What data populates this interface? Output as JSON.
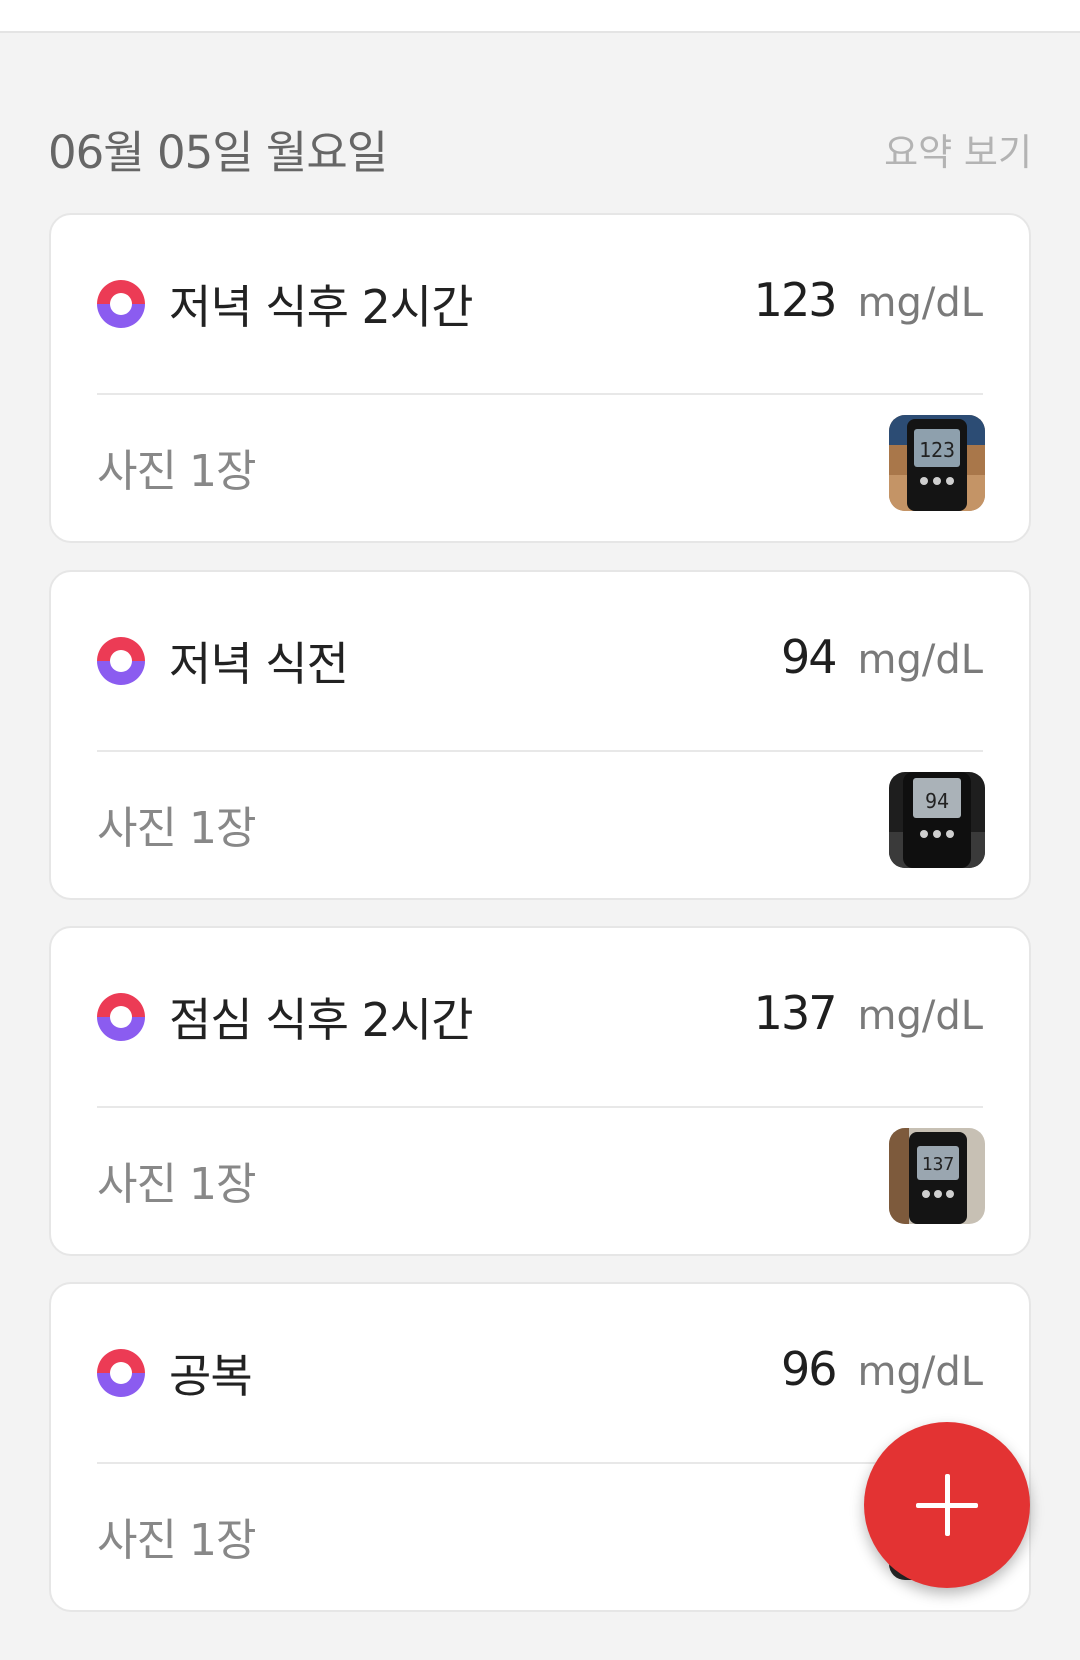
{
  "header": {
    "date": "06월 05일 월요일",
    "summary_link": "요약 보기"
  },
  "records": [
    {
      "label": "저녁 식후 2시간",
      "value": "123",
      "unit": "mg/dL",
      "photos": "사진 1장",
      "thumb_icon": "glucometer-photo"
    },
    {
      "label": "저녁 식전",
      "value": "94",
      "unit": "mg/dL",
      "photos": "사진 1장",
      "thumb_icon": "glucometer-photo"
    },
    {
      "label": "점심 식후 2시간",
      "value": "137",
      "unit": "mg/dL",
      "photos": "사진 1장",
      "thumb_icon": "glucometer-photo"
    },
    {
      "label": "공복",
      "value": "96",
      "unit": "mg/dL",
      "photos": "사진 1장",
      "thumb_icon": "glucometer-photo"
    }
  ],
  "colors": {
    "dot_top": "#ec3b55",
    "dot_bottom": "#8b5cf0",
    "fab": "#e33333",
    "background": "#f3f3f3"
  },
  "fab": {
    "icon": "plus-icon"
  }
}
